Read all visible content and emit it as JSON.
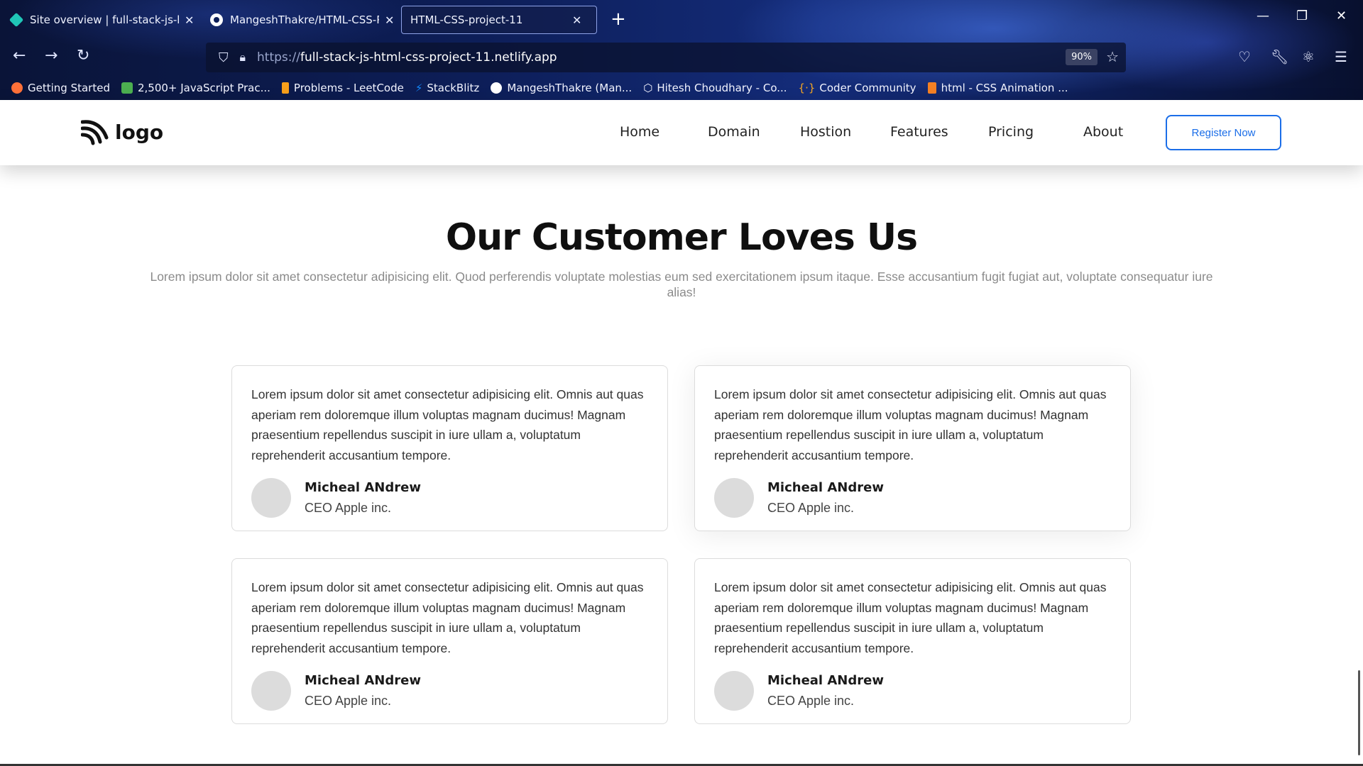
{
  "browser": {
    "tabs": [
      {
        "title": "Site overview | full-stack-js-html",
        "favicon": "netlify-icon",
        "active": false
      },
      {
        "title": "MangeshThakre/HTML-CSS-Pro",
        "favicon": "github-icon",
        "active": false
      },
      {
        "title": "HTML-CSS-project-11",
        "favicon": "",
        "active": true
      }
    ],
    "new_tab_label": "+",
    "url_protocol": "https://",
    "url_host": "full-stack-js-html-css-project-11.netlify.app",
    "zoom": "90%",
    "bookmarks": [
      {
        "label": "Getting Started",
        "icon": "firefox-icon",
        "color": "#ff7139"
      },
      {
        "label": "2,500+ JavaScript Prac...",
        "icon": "w3resource-icon",
        "color": "#4caf50"
      },
      {
        "label": "Problems - LeetCode",
        "icon": "leetcode-icon",
        "color": "#f89f1b"
      },
      {
        "label": "StackBlitz",
        "icon": "bolt-icon",
        "color": "#1389fd"
      },
      {
        "label": "MangeshThakre (Man...",
        "icon": "github-icon",
        "color": "#ffffff"
      },
      {
        "label": "Hitesh Choudhary - Co...",
        "icon": "cube-icon",
        "color": "#ffffff"
      },
      {
        "label": "Coder Community",
        "icon": "braces-icon",
        "color": "#f5a623"
      },
      {
        "label": "html - CSS Animation ...",
        "icon": "stackoverflow-icon",
        "color": "#f48024"
      }
    ]
  },
  "site": {
    "logo_text": "logo",
    "menu": [
      "Home",
      "Domain",
      "Hostion",
      "Features",
      "Pricing",
      "About"
    ],
    "register_label": "Register Now"
  },
  "section": {
    "title": "Our Customer Loves Us",
    "subtitle": "Lorem ipsum dolor sit amet consectetur adipisicing elit. Quod perferendis voluptate molestias eum sed exercitationem ipsum itaque. Esse accusantium fugit fugiat aut, voluptate consequatur iure alias!"
  },
  "testimonials": [
    {
      "text": "Lorem ipsum dolor sit amet consectetur adipisicing elit. Omnis aut quas aperiam rem doloremque illum voluptas magnam ducimus! Magnam praesentium repellendus suscipit in iure ullam a, voluptatum reprehenderit accusantium tempore.",
      "name": "Micheal ANdrew",
      "role": "CEO Apple inc."
    },
    {
      "text": "Lorem ipsum dolor sit amet consectetur adipisicing elit. Omnis aut quas aperiam rem doloremque illum voluptas magnam ducimus! Magnam praesentium repellendus suscipit in iure ullam a, voluptatum reprehenderit accusantium tempore.",
      "name": "Micheal ANdrew",
      "role": "CEO Apple inc."
    },
    {
      "text": "Lorem ipsum dolor sit amet consectetur adipisicing elit. Omnis aut quas aperiam rem doloremque illum voluptas magnam ducimus! Magnam praesentium repellendus suscipit in iure ullam a, voluptatum reprehenderit accusantium tempore.",
      "name": "Micheal ANdrew",
      "role": "CEO Apple inc."
    },
    {
      "text": "Lorem ipsum dolor sit amet consectetur adipisicing elit. Omnis aut quas aperiam rem doloremque illum voluptas magnam ducimus! Magnam praesentium repellendus suscipit in iure ullam a, voluptatum reprehenderit accusantium tempore.",
      "name": "Micheal ANdrew",
      "role": "CEO Apple inc."
    }
  ]
}
